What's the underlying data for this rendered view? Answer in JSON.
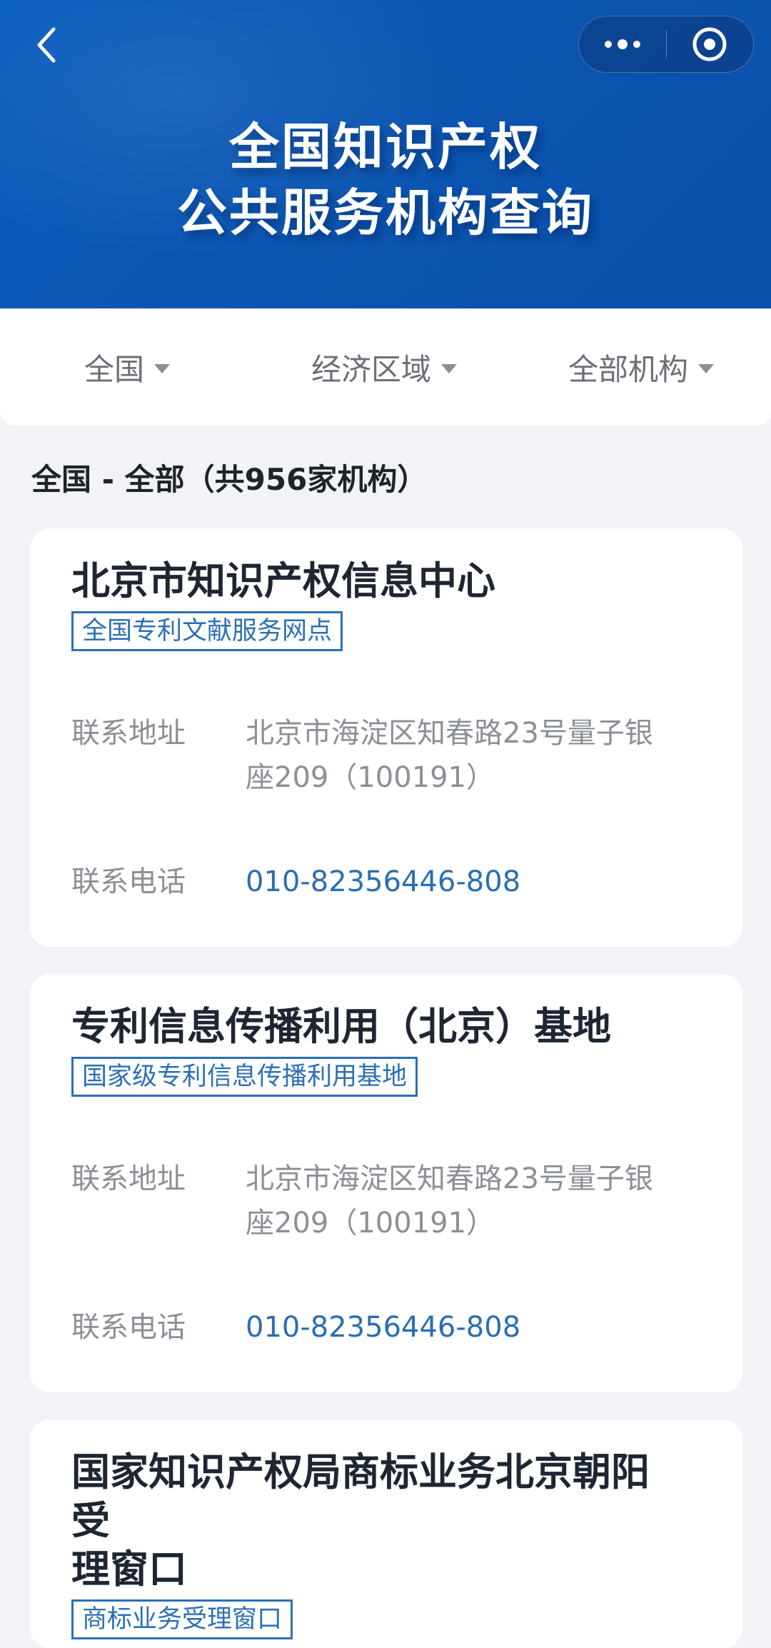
{
  "header": {
    "title_line1": "全国知识产权",
    "title_line2": "公共服务机构查询",
    "back_icon": "chevron-left-icon",
    "more_icon": "more-dots-icon",
    "close_icon": "target-circle-icon"
  },
  "filters": [
    {
      "label": "全国"
    },
    {
      "label": "经济区域"
    },
    {
      "label": "全部机构"
    }
  ],
  "summary": "全国 - 全部（共956家机构）",
  "cards": [
    {
      "name": "北京市知识产权信息中心",
      "tag": "全国专利文献服务网点",
      "address_label": "联系地址",
      "address_line1": "北京市海淀区知春路23号量子银",
      "address_line2": "座209（100191）",
      "phone_label": "联系电话",
      "phone": "010-82356446-808"
    },
    {
      "name": "专利信息传播利用（北京）基地",
      "tag": "国家级专利信息传播利用基地",
      "address_label": "联系地址",
      "address_line1": "北京市海淀区知春路23号量子银",
      "address_line2": "座209（100191）",
      "phone_label": "联系电话",
      "phone": "010-82356446-808"
    },
    {
      "name_line1": "国家知识产权局商标业务北京朝阳受",
      "name_line2": "理窗口",
      "tag": "商标业务受理窗口"
    }
  ],
  "colors": {
    "header_bg": "#0b56b3",
    "accent_blue": "#2c6fb6",
    "phone_blue": "#2a6eb3",
    "page_bg": "#f1f3f6"
  }
}
